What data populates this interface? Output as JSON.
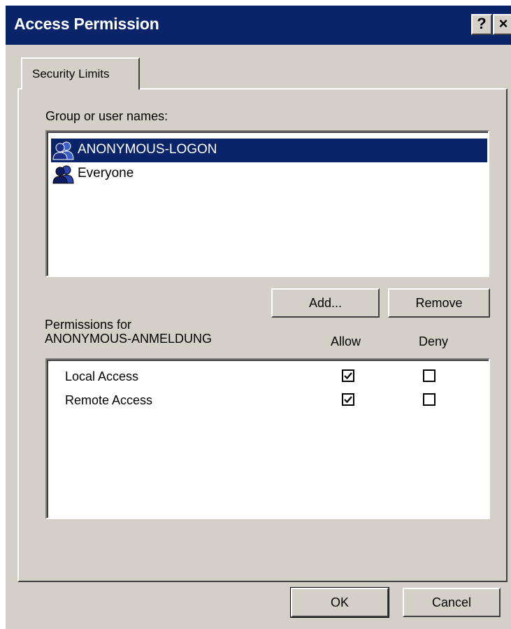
{
  "window": {
    "title": "Access Permission",
    "help_glyph": "?",
    "close_glyph": "×"
  },
  "tabs": [
    {
      "label": "Security Limits",
      "active": true
    }
  ],
  "group_section": {
    "label": "Group or user names:",
    "users": [
      {
        "name": "ANONYMOUS-LOGON",
        "icon": "user-group-icon",
        "selected": true
      },
      {
        "name": "Everyone",
        "icon": "user-group-icon",
        "selected": false
      }
    ],
    "add_button": "Add...",
    "remove_button": "Remove"
  },
  "permissions": {
    "label_line1": "Permissions for",
    "label_line2": "ANONYMOUS-ANMELDUNG",
    "col_allow": "Allow",
    "col_deny": "Deny",
    "rows": [
      {
        "name": "Local Access",
        "allow": true,
        "deny": false
      },
      {
        "name": "Remote Access",
        "allow": true,
        "deny": false
      }
    ]
  },
  "footer": {
    "ok_button": "OK",
    "cancel_button": "Cancel"
  },
  "colors": {
    "titlebar": "#0a246a",
    "face": "#d4d0c8",
    "selection": "#0a246a"
  }
}
